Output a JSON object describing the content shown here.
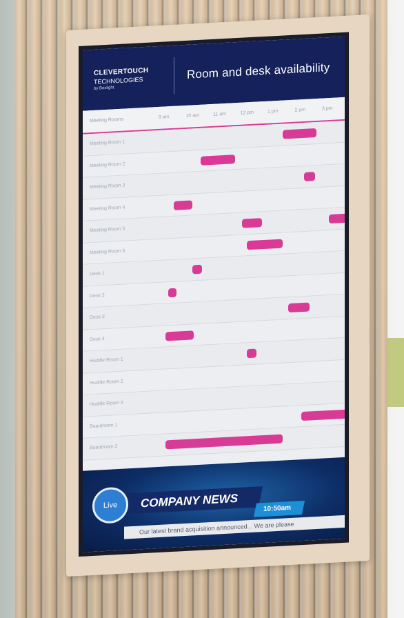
{
  "header": {
    "brand_line1": "CLEVERTOUCH",
    "brand_line2": "TECHNOLOGIES",
    "brand_line3": "by Boxlight",
    "title": "Room and desk availability"
  },
  "schedule": {
    "corner_label": "Meeting Rooms",
    "time_slots": [
      "9 am",
      "10 am",
      "11 am",
      "12 pm",
      "1 pm",
      "2 pm",
      "3 pm"
    ],
    "rows": [
      {
        "label": "Meeting Room 1",
        "bookings": [
          {
            "start": 13.5,
            "end": 14.75
          }
        ]
      },
      {
        "label": "Meeting Room 2",
        "bookings": [
          {
            "start": 10.5,
            "end": 11.75
          }
        ]
      },
      {
        "label": "Meeting Room 3",
        "bookings": [
          {
            "start": 14.3,
            "end": 14.7
          }
        ]
      },
      {
        "label": "Meeting Room 4",
        "bookings": [
          {
            "start": 9.5,
            "end": 10.2
          }
        ]
      },
      {
        "label": "Meeting Room 5",
        "bookings": [
          {
            "start": 12.0,
            "end": 12.75
          },
          {
            "start": 15.2,
            "end": 15.9
          }
        ]
      },
      {
        "label": "Meeting Room 6",
        "bookings": [
          {
            "start": 12.2,
            "end": 13.5
          }
        ]
      },
      {
        "label": "Desk 1",
        "bookings": [
          {
            "start": 10.2,
            "end": 10.55
          }
        ]
      },
      {
        "label": "Desk 2",
        "bookings": [
          {
            "start": 9.3,
            "end": 9.6
          }
        ]
      },
      {
        "label": "Desk 3",
        "bookings": [
          {
            "start": 13.7,
            "end": 14.5
          }
        ]
      },
      {
        "label": "Desk 4",
        "bookings": [
          {
            "start": 9.2,
            "end": 10.25
          }
        ]
      },
      {
        "label": "Huddle Room 1",
        "bookings": [
          {
            "start": 12.2,
            "end": 12.55
          }
        ]
      },
      {
        "label": "Huddle Room 2",
        "bookings": []
      },
      {
        "label": "Huddle Room 3",
        "bookings": []
      },
      {
        "label": "Boardroom 1",
        "bookings": [
          {
            "start": 14.2,
            "end": 16.0
          }
        ]
      },
      {
        "label": "Boardroom 2",
        "bookings": [
          {
            "start": 9.2,
            "end": 13.5
          }
        ]
      }
    ]
  },
  "footer": {
    "live_label": "Live",
    "news_title": "COMPANY NEWS",
    "time": "10:50am",
    "ticker": "Our latest brand acquisition announced... We are please"
  },
  "colors": {
    "header_bg": "#15215a",
    "booking": "#d83b96",
    "footer_blue": "#0d2d66"
  }
}
